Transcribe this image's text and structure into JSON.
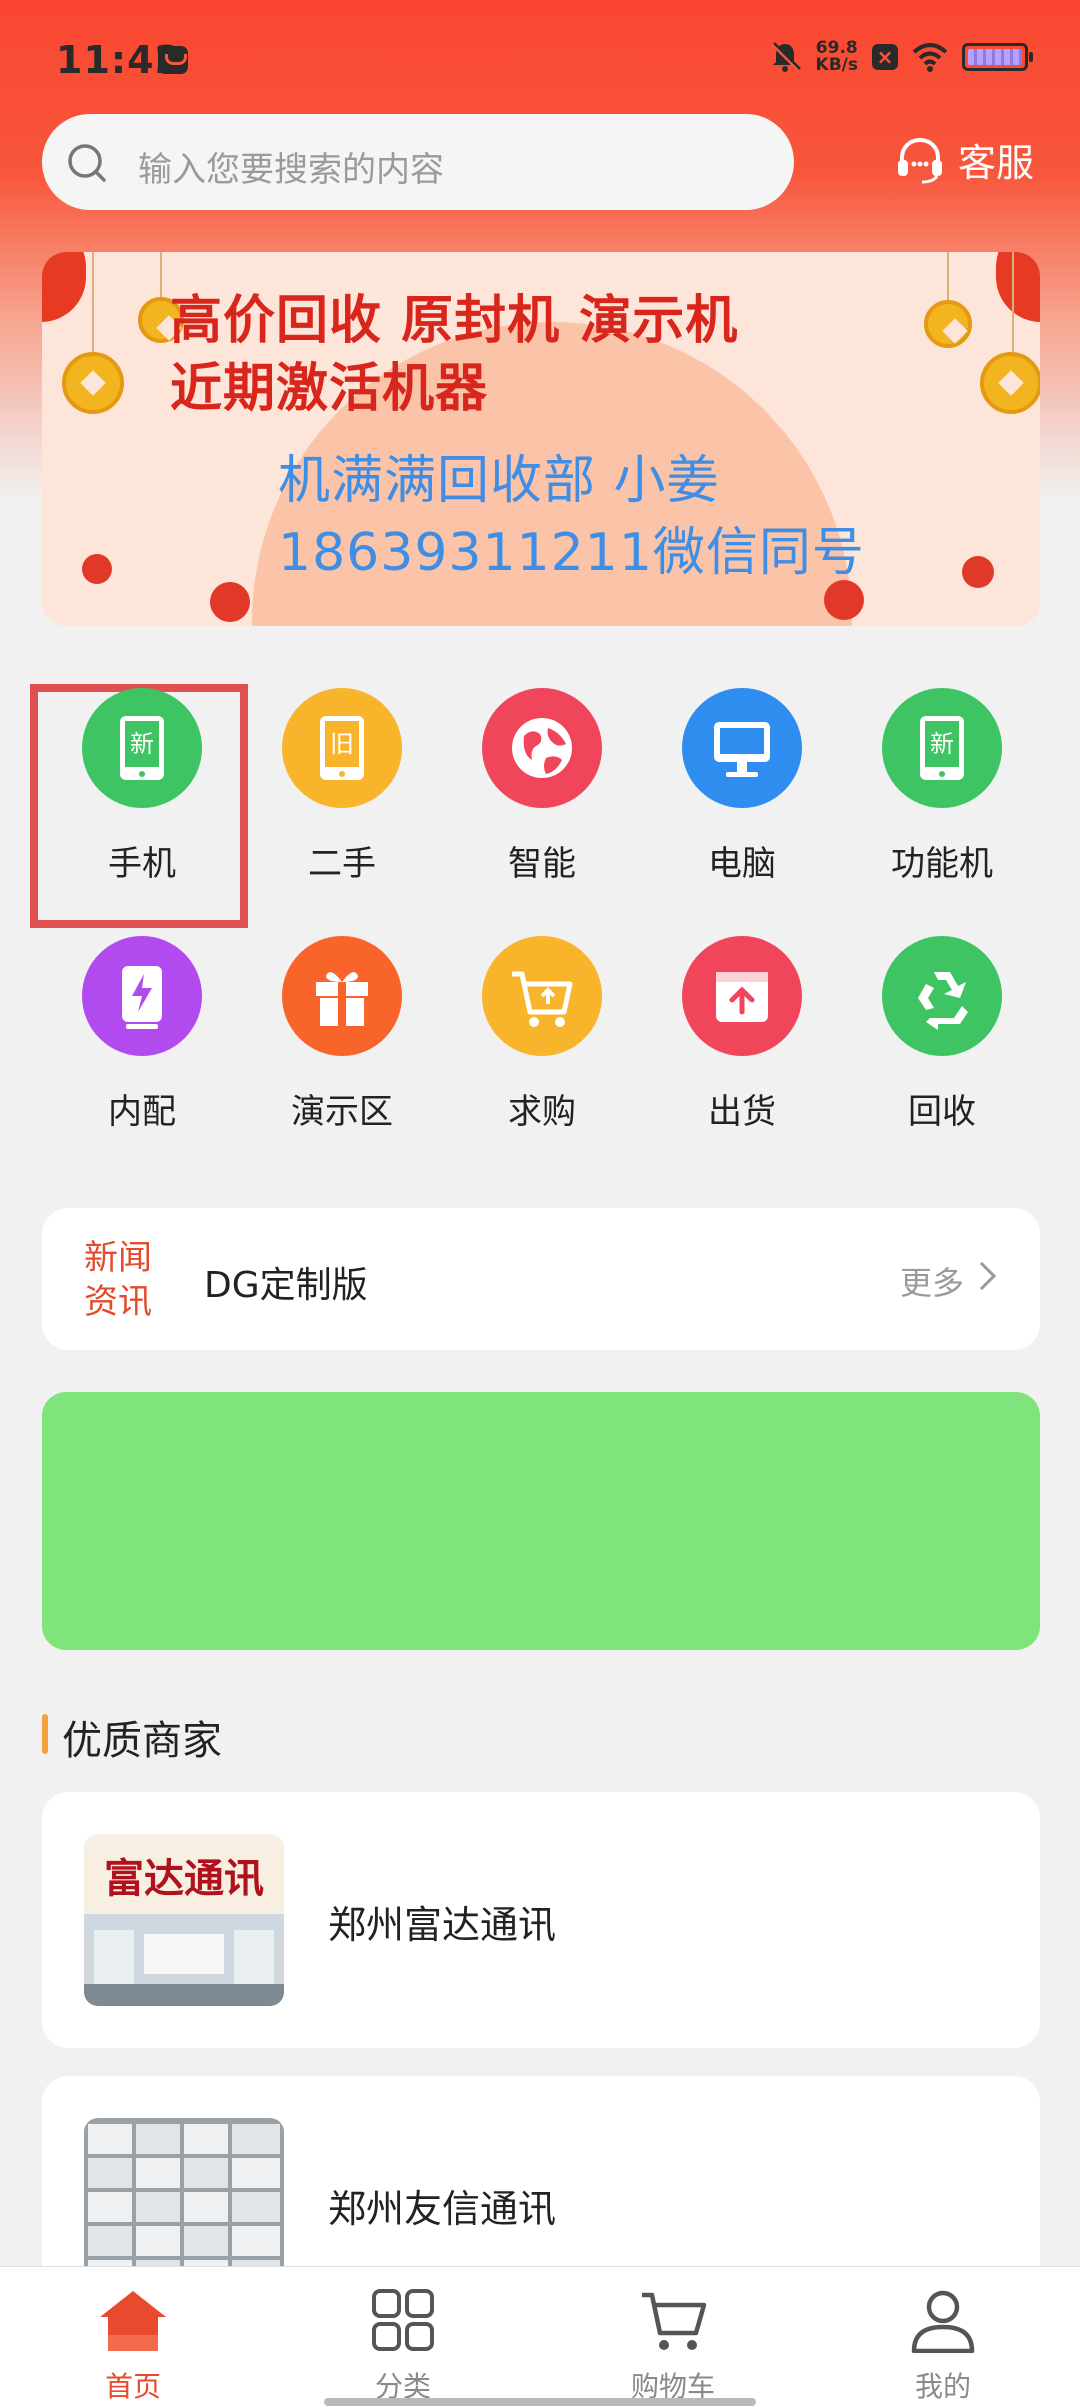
{
  "status_bar": {
    "time": "11:42",
    "net_speed_value": "69.8",
    "net_speed_unit": "KB/s"
  },
  "search": {
    "placeholder": "输入您要搜索的内容"
  },
  "customer_service": {
    "label": "客服"
  },
  "banner": {
    "line1": "高价回收   原封机  演示机",
    "line2": "近期激活机器",
    "line3": "机满满回收部  小姜",
    "line4": "18639311211微信同号"
  },
  "categories": [
    {
      "label": "手机",
      "icon": "new-phone-icon",
      "color": "#3fc463"
    },
    {
      "label": "二手",
      "icon": "used-phone-icon",
      "color": "#f8b42a"
    },
    {
      "label": "智能",
      "icon": "globe-icon",
      "color": "#f0455a"
    },
    {
      "label": "电脑",
      "icon": "computer-icon",
      "color": "#2f8df0"
    },
    {
      "label": "功能机",
      "icon": "new-phone-icon",
      "color": "#3fc463"
    },
    {
      "label": "内配",
      "icon": "battery-charge-icon",
      "color": "#b24bef"
    },
    {
      "label": "演示区",
      "icon": "gift-icon",
      "color": "#f8642a"
    },
    {
      "label": "求购",
      "icon": "cart-icon",
      "color": "#f8b42a"
    },
    {
      "label": "出货",
      "icon": "upload-box-icon",
      "color": "#f0455a"
    },
    {
      "label": "回收",
      "icon": "recycle-icon",
      "color": "#3fc463"
    }
  ],
  "category_glyphs": {
    "new": "新",
    "used": "旧"
  },
  "news": {
    "tag_line1": "新闻",
    "tag_line2": "资讯",
    "headline": "DG定制版",
    "more": "更多"
  },
  "featured_merchants": {
    "title": "优质商家",
    "shops": [
      {
        "name": "郑州富达通讯",
        "sign": "富达通讯"
      },
      {
        "name": "郑州友信通讯"
      }
    ]
  },
  "tabbar": {
    "items": [
      {
        "label": "首页",
        "active": true
      },
      {
        "label": "分类",
        "active": false
      },
      {
        "label": "购物车",
        "active": false
      },
      {
        "label": "我的",
        "active": false
      }
    ]
  },
  "colors": {
    "accent": "#e84a2e",
    "header_red": "#fa4630",
    "highlight": "#e05050",
    "green_banner": "#80e47d"
  }
}
